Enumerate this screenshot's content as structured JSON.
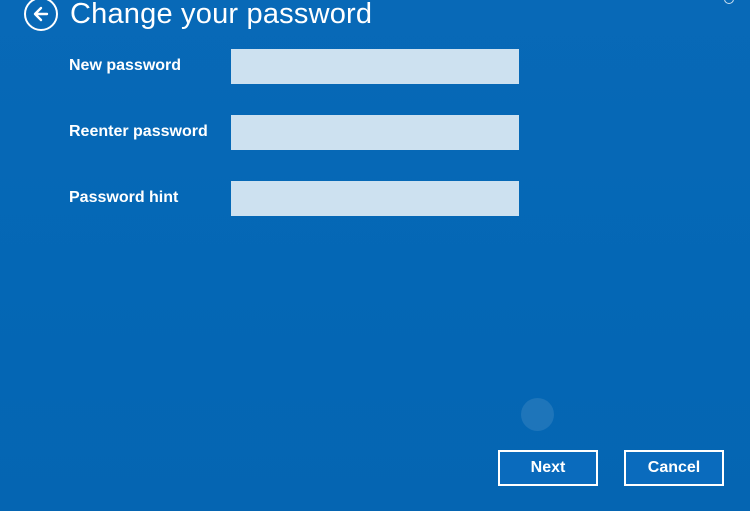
{
  "header": {
    "title": "Change your password",
    "back_icon": "back-arrow-icon"
  },
  "form": {
    "fields": [
      {
        "label": "New password",
        "value": ""
      },
      {
        "label": "Reenter password",
        "value": ""
      },
      {
        "label": "Password hint",
        "value": ""
      }
    ]
  },
  "buttons": {
    "next_label": "Next",
    "cancel_label": "Cancel"
  },
  "colors": {
    "background": "#0467b5",
    "input_background": "#cde1f0",
    "text": "#ffffff"
  }
}
